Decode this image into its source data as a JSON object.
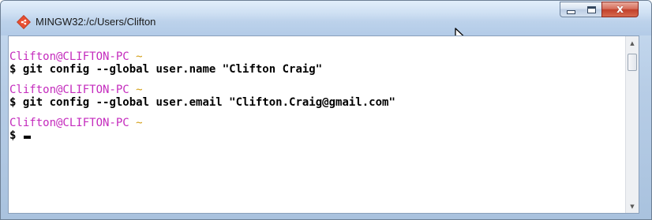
{
  "window": {
    "title": "MINGW32:/c/Users/Clifton",
    "icon": "git-icon",
    "close_glyph": "x"
  },
  "terminal": {
    "blocks": [
      {
        "host": "Clifton@CLIFTON-PC",
        "cwd": "~",
        "prompt_symbol": "$",
        "command": "git config --global user.name \"Clifton Craig\""
      },
      {
        "host": "Clifton@CLIFTON-PC",
        "cwd": "~",
        "prompt_symbol": "$",
        "command": "git config --global user.email \"Clifton.Craig@gmail.com\""
      },
      {
        "host": "Clifton@CLIFTON-PC",
        "cwd": "~",
        "prompt_symbol": "$",
        "command": ""
      }
    ]
  },
  "colors": {
    "prompt_host": "#c42bbd",
    "prompt_cwd": "#d4a017",
    "text": "#000000",
    "background": "#ffffff"
  },
  "scrollbar": {
    "up_glyph": "▲",
    "down_glyph": "▼"
  }
}
